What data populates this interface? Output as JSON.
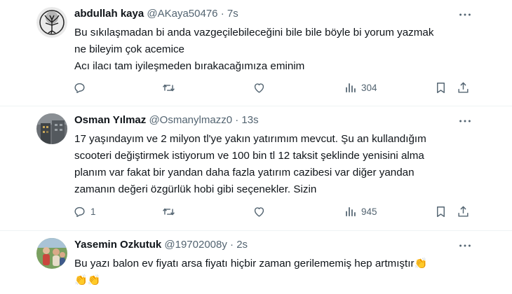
{
  "tweets": [
    {
      "name": "abdullah kaya",
      "handle": "@AKaya50476",
      "time": "· 7s",
      "lines": [
        "Bu sıkılaşmadan bi anda vazgeçilebileceğini bile bile böyle bi yorum yazmak",
        "ne bileyim çok acemice",
        "Acı ilacı tam iyileşmeden bırakacağımıza eminim"
      ],
      "replies": "",
      "retweets": "",
      "likes": "",
      "views": "304",
      "avatar_icon": "tree-avatar-icon"
    },
    {
      "name": "Osman Yılmaz",
      "handle": "@Osmanylmazz0",
      "time": "· 13s",
      "lines": [
        "17 yaşındayım ve 2 milyon tl'ye yakın yatırımım mevcut.  Şu an kullandığım",
        "scooteri değiştirmek istiyorum ve 100 bin tl 12 taksit şeklinde yenisini alma",
        "planım var fakat bir yandan daha fazla yatırım cazibesi var diğer yandan",
        "zamanın değeri özgürlük hobi gibi seçenekler. Sizin"
      ],
      "replies": "1",
      "retweets": "",
      "likes": "",
      "views": "945",
      "avatar_icon": "building-avatar-icon"
    },
    {
      "name": "Yasemin Ozkutuk",
      "handle": "@19702008y",
      "time": "· 2s",
      "lines": [
        "Bu yazı balon ev fiyatı arsa fiyatı hiçbir zaman gerilememiş hep artmıştır"
      ],
      "emoji": "👏",
      "avatar_icon": "people-photo-avatar-icon"
    }
  ],
  "colors": {
    "text": "#0f1419",
    "muted": "#536471",
    "divider": "#eff3f4"
  },
  "icons": [
    "more-icon",
    "reply-icon",
    "retweet-icon",
    "like-icon",
    "views-icon",
    "bookmark-icon",
    "share-icon"
  ]
}
